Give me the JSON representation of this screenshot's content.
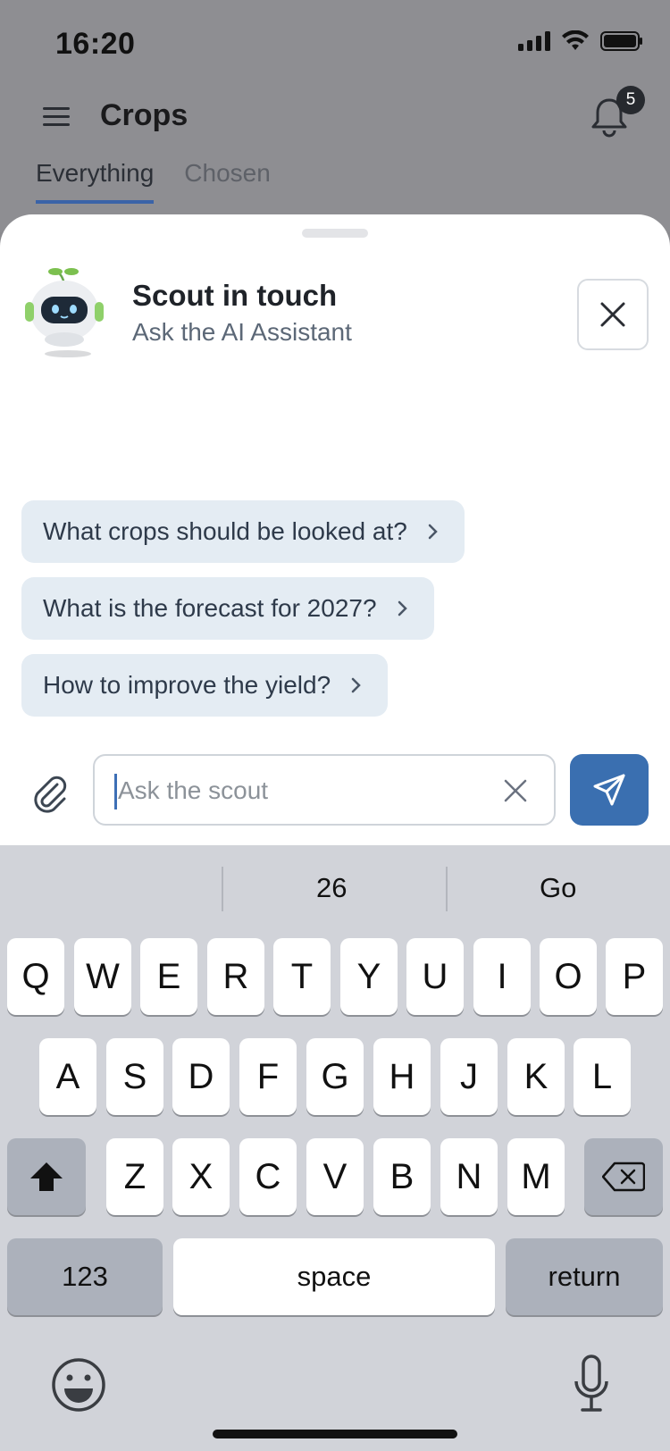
{
  "status_bar": {
    "time": "16:20"
  },
  "app": {
    "title": "Crops",
    "notification_count": "5",
    "tabs": [
      {
        "label": "Everything",
        "active": true
      },
      {
        "label": "Chosen",
        "active": false
      }
    ]
  },
  "sheet": {
    "title": "Scout in touch",
    "subtitle": "Ask the AI Assistant",
    "suggestions": [
      "What crops should be looked at?",
      "What is the forecast for 2027?",
      "How to improve the yield?"
    ],
    "input": {
      "placeholder": "Ask the scout",
      "value": ""
    }
  },
  "keyboard": {
    "predictions": [
      "",
      "26",
      "Go"
    ],
    "row1": [
      "Q",
      "W",
      "E",
      "R",
      "T",
      "Y",
      "U",
      "I",
      "O",
      "P"
    ],
    "row2": [
      "A",
      "S",
      "D",
      "F",
      "G",
      "H",
      "J",
      "K",
      "L"
    ],
    "row3": [
      "Z",
      "X",
      "C",
      "V",
      "B",
      "N",
      "M"
    ],
    "numbers_label": "123",
    "space_label": "space",
    "return_label": "return"
  },
  "colors": {
    "accent": "#3a6fb0",
    "chip_bg": "#e4ecf3",
    "keyboard_bg": "#d1d3d9"
  }
}
